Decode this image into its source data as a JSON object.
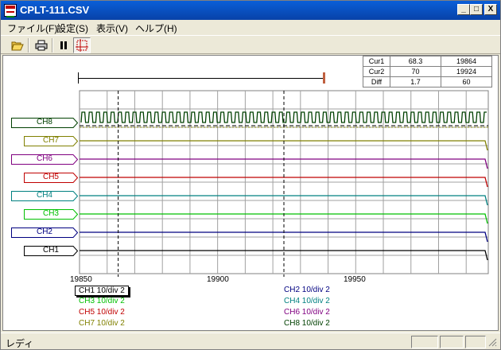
{
  "window": {
    "title": "CPLT-111.CSV",
    "min_glyph": "_",
    "max_glyph": "□",
    "close_glyph": "X"
  },
  "menu": [
    {
      "label": "ファイル(F)"
    },
    {
      "label": "設定(S)"
    },
    {
      "label": "表示(V)"
    },
    {
      "label": "ヘルプ(H)"
    }
  ],
  "toolbar": {
    "open_icon": "folder-open-icon",
    "print_icon": "printer-icon",
    "pause_icon": "pause-icon",
    "cursor_icon": "cursor-grid-icon"
  },
  "cursor_table": {
    "rows": [
      {
        "label": "Cur1",
        "value": "68.3",
        "pos": "19864"
      },
      {
        "label": "Cur2",
        "value": "70",
        "pos": "19924"
      },
      {
        "label": "Diff",
        "value": "1.7",
        "pos": "60"
      }
    ]
  },
  "chart_data": {
    "type": "line",
    "x_ticks": [
      "19850",
      "19900",
      "19950"
    ],
    "xlim": [
      19850,
      19998
    ],
    "cursors": [
      19864,
      19924
    ],
    "view_range": [
      19850,
      19940
    ],
    "grid": true,
    "channels": [
      {
        "name": "CH8",
        "color": "#004000",
        "signal": "square"
      },
      {
        "name": "CH7",
        "color": "#808000",
        "signal": "flat"
      },
      {
        "name": "CH6",
        "color": "#800080",
        "signal": "flat"
      },
      {
        "name": "CH5",
        "color": "#c00000",
        "signal": "flat"
      },
      {
        "name": "CH4",
        "color": "#008080",
        "signal": "flat"
      },
      {
        "name": "CH3",
        "color": "#00c000",
        "signal": "flat"
      },
      {
        "name": "CH2",
        "color": "#000080",
        "signal": "flat"
      },
      {
        "name": "CH1",
        "color": "#000000",
        "signal": "flat"
      }
    ]
  },
  "scale_info": [
    {
      "text": "CH1 10/div  2",
      "color": "#000000"
    },
    {
      "text": "CH2 10/div  2",
      "color": "#000080"
    },
    {
      "text": "CH3 10/div  2",
      "color": "#00c000"
    },
    {
      "text": "CH4 10/div  2",
      "color": "#008080"
    },
    {
      "text": "CH5 10/div  2",
      "color": "#c00000"
    },
    {
      "text": "CH6 10/div  2",
      "color": "#800080"
    },
    {
      "text": "CH7 10/div  2",
      "color": "#808000"
    },
    {
      "text": "CH8 10/div  2",
      "color": "#004000"
    }
  ],
  "status": {
    "text": "レディ"
  }
}
